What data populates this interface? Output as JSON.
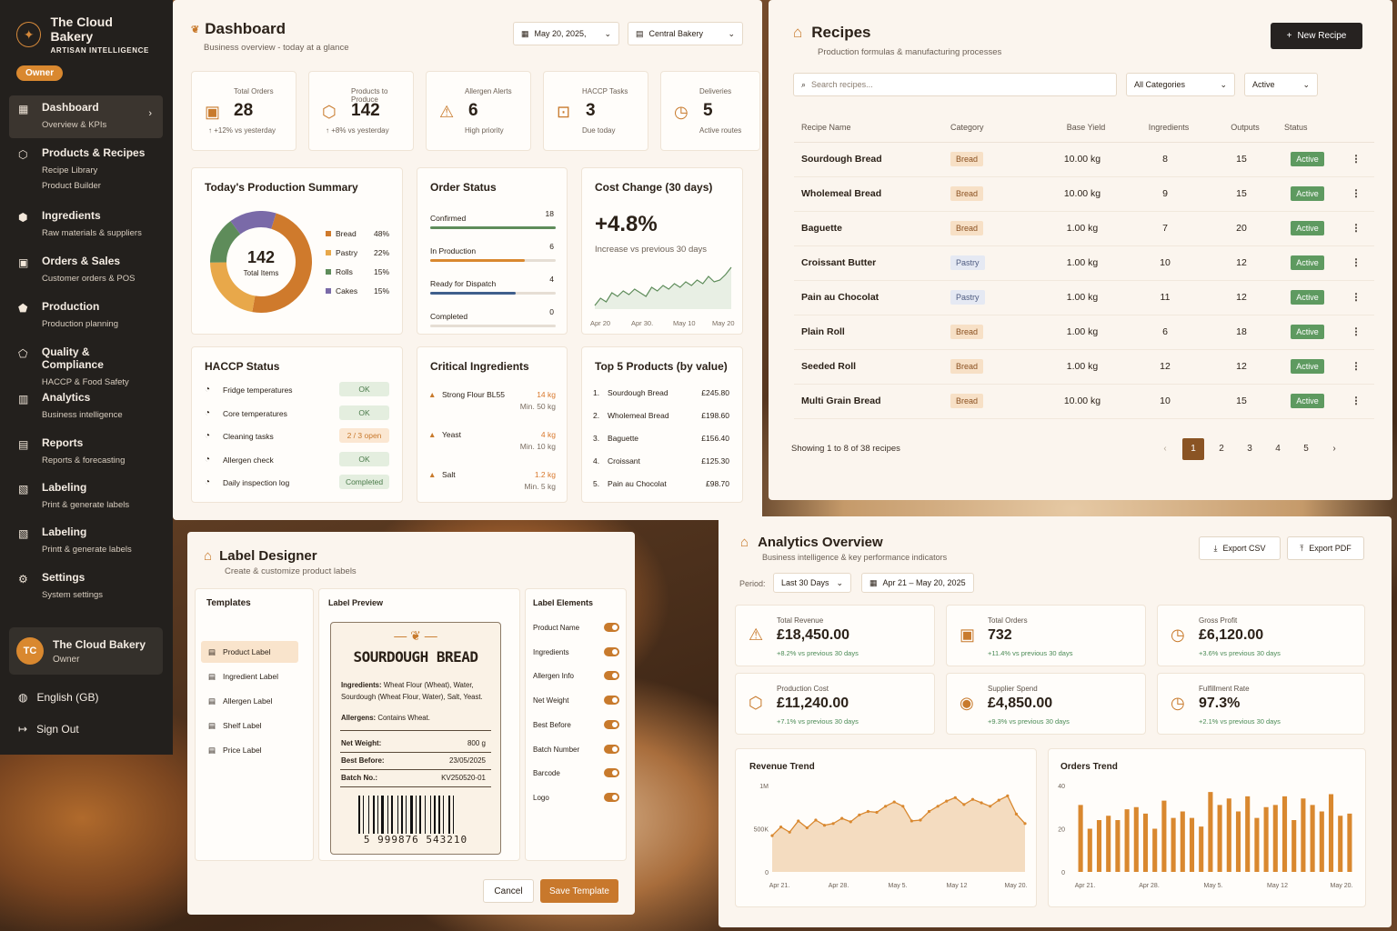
{
  "sidebar": {
    "brand": "The Cloud Bakery",
    "tagline": "ARTISAN INTELLIGENCE",
    "role": "Owner",
    "items": [
      {
        "title": "Dashboard",
        "sub": [
          "Overview & KPIs"
        ],
        "icon": "grid-icon"
      },
      {
        "title": "Products & Recipes",
        "sub": [
          "Recipe Library",
          "Product Builder"
        ],
        "icon": "box-icon"
      },
      {
        "title": "Ingredients",
        "sub": [
          "Raw materials & suppliers"
        ],
        "icon": "ingredient-icon"
      },
      {
        "title": "Orders & Sales",
        "sub": [
          "Customer orders & POS"
        ],
        "icon": "orders-icon"
      },
      {
        "title": "Production",
        "sub": [
          "Production planning"
        ],
        "icon": "production-icon"
      },
      {
        "title": "Quality & Compliance",
        "sub": [
          "HACCP & Food Safety"
        ],
        "icon": "shield-icon"
      },
      {
        "title": "Analytics",
        "sub": [
          "Business intelligence"
        ],
        "icon": "analytics-icon"
      },
      {
        "title": "Reports",
        "sub": [
          "Reports & forecasting"
        ],
        "icon": "reports-icon"
      },
      {
        "title": "Labeling",
        "sub": [
          "Print & generate labels"
        ],
        "icon": "label-icon"
      },
      {
        "title": "Labeling",
        "sub": [
          "Printt & generate labels"
        ],
        "icon": "label-icon"
      },
      {
        "title": "Settings",
        "sub": [
          "System settings"
        ],
        "icon": "gear-icon"
      }
    ],
    "user": {
      "initials": "TC",
      "name": "The Cloud Bakery",
      "role": "Owner"
    },
    "language": "English (GB)",
    "signout": "Sign Out"
  },
  "dashboard": {
    "title": "Dashboard",
    "subtitle": "Business overview - today at a glance",
    "date": "May 20, 2025,",
    "location": "Central Bakery",
    "kpis": [
      {
        "label": "Total Orders",
        "value": "28",
        "note": "↑ +12% vs yesterday"
      },
      {
        "label": "Products to Produce",
        "value": "142",
        "note": "↑ +8% vs yesterday"
      },
      {
        "label": "Allergen Alerts",
        "value": "6",
        "note": "High priority"
      },
      {
        "label": "HACCP Tasks",
        "value": "3",
        "note": "Due today"
      },
      {
        "label": "Deliveries",
        "value": "5",
        "note": "Active routes"
      }
    ],
    "summary": {
      "title": "Today's Production Summary",
      "total": "142",
      "total_label": "Total Items",
      "legend": [
        {
          "name": "Bread",
          "pct": "48%",
          "value": 48,
          "color": "#cf7a2c"
        },
        {
          "name": "Pastry",
          "pct": "22%",
          "value": 22,
          "color": "#e8a84a"
        },
        {
          "name": "Rolls",
          "pct": "15%",
          "value": 15,
          "color": "#5e8c5a"
        },
        {
          "name": "Cakes",
          "pct": "15%",
          "value": 15,
          "color": "#7a6aa8"
        }
      ]
    },
    "order_status": {
      "title": "Order Status",
      "items": [
        {
          "label": "Confirmed",
          "count": "18",
          "fill": 1.0,
          "color": "#5e8c5a"
        },
        {
          "label": "In Production",
          "count": "6",
          "fill": 0.75,
          "color": "#d9882f"
        },
        {
          "label": "Ready for Dispatch",
          "count": "4",
          "fill": 0.68,
          "color": "#3f5f8c"
        },
        {
          "label": "Completed",
          "count": "0",
          "fill": 0,
          "color": "#999"
        }
      ]
    },
    "cost": {
      "title": "Cost Change (30 days)",
      "value": "+4.8%",
      "note": "Increase vs previous 30 days",
      "ticks": [
        "Apr 20",
        "Apr 30.",
        "May 10",
        "May 20"
      ]
    },
    "haccp": {
      "title": "HACCP Status",
      "items": [
        {
          "label": "Fridge temperatures",
          "status": "OK"
        },
        {
          "label": "Core temperatures",
          "status": "OK"
        },
        {
          "label": "Cleaning tasks",
          "status": "2 / 3 open"
        },
        {
          "label": "Allergen check",
          "status": "OK"
        },
        {
          "label": "Daily inspection log",
          "status": "Completed"
        }
      ]
    },
    "critical": {
      "title": "Critical Ingredients",
      "items": [
        {
          "name": "Strong Flour BL55",
          "qty": "14 kg",
          "min": "Min. 50 kg"
        },
        {
          "name": "Yeast",
          "qty": "4 kg",
          "min": "Min. 10 kg"
        },
        {
          "name": "Salt",
          "qty": "1.2 kg",
          "min": "Min. 5 kg"
        }
      ]
    },
    "top5": {
      "title": "Top 5 Products (by value)",
      "items": [
        {
          "rank": "1.",
          "name": "Sourdough Bread",
          "value": "£245.80"
        },
        {
          "rank": "2.",
          "name": "Wholemeal Bread",
          "value": "£198.60"
        },
        {
          "rank": "3.",
          "name": "Baguette",
          "value": "£156.40"
        },
        {
          "rank": "4.",
          "name": "Croissant",
          "value": "£125.30"
        },
        {
          "rank": "5.",
          "name": "Pain au Chocolat",
          "value": "£98.70"
        }
      ]
    }
  },
  "recipes": {
    "title": "Recipes",
    "subtitle": "Production formulas & manufacturing processes",
    "new_button": "New Recipe",
    "search_placeholder": "Search recipes...",
    "category_filter": "All Categories",
    "status_filter": "Active",
    "headers": [
      "Recipe Name",
      "Category",
      "Base Yield",
      "Ingredients",
      "Outputs",
      "Status"
    ],
    "rows": [
      {
        "name": "Sourdough Bread",
        "category": "Bread",
        "yield": "10.00 kg",
        "ingredients": "8",
        "outputs": "15",
        "status": "Active"
      },
      {
        "name": "Wholemeal Bread",
        "category": "Bread",
        "yield": "10.00 kg",
        "ingredients": "9",
        "outputs": "15",
        "status": "Active"
      },
      {
        "name": "Baguette",
        "category": "Bread",
        "yield": "1.00 kg",
        "ingredients": "7",
        "outputs": "20",
        "status": "Active"
      },
      {
        "name": "Croissant Butter",
        "category": "Pastry",
        "yield": "1.00 kg",
        "ingredients": "10",
        "outputs": "12",
        "status": "Active"
      },
      {
        "name": "Pain au Chocolat",
        "category": "Pastry",
        "yield": "1.00 kg",
        "ingredients": "11",
        "outputs": "12",
        "status": "Active"
      },
      {
        "name": "Plain Roll",
        "category": "Bread",
        "yield": "1.00 kg",
        "ingredients": "6",
        "outputs": "18",
        "status": "Active"
      },
      {
        "name": "Seeded Roll",
        "category": "Bread",
        "yield": "1.00 kg",
        "ingredients": "12",
        "outputs": "12",
        "status": "Active"
      },
      {
        "name": "Multi Grain Bread",
        "category": "Bread",
        "yield": "10.00 kg",
        "ingredients": "10",
        "outputs": "15",
        "status": "Active"
      }
    ],
    "showing": "Showing 1 to 8 of 38 recipes",
    "pages": [
      "1",
      "2",
      "3",
      "4",
      "5"
    ],
    "prev": "‹",
    "next": "›"
  },
  "label_designer": {
    "title": "Label Designer",
    "subtitle": "Create & customize product labels",
    "templates_title": "Templates",
    "templates": [
      "Product Label",
      "Ingredient Label",
      "Allergen Label",
      "Shelf Label",
      "Price Label"
    ],
    "preview_title": "Label Preview",
    "product": "SOURDOUGH BREAD",
    "ingredients_label": "Ingredients:",
    "ingredients": "Wheat Flour (Wheat), Water, Sourdough (Wheat Flour, Water), Salt, Yeast.",
    "allergens_label": "Allergens:",
    "allergens": "Contains Wheat.",
    "fields": [
      {
        "k": "Net Weight:",
        "v": "800 g"
      },
      {
        "k": "Best Before:",
        "v": "23/05/2025"
      },
      {
        "k": "Batch No.:",
        "v": "KV250520-01"
      }
    ],
    "barcode_digits": "5 999876 543210",
    "elements_title": "Label Elements",
    "elements": [
      "Product Name",
      "Ingredients",
      "Allergen Info",
      "Net Weight",
      "Best Before",
      "Batch Number",
      "Barcode",
      "Logo"
    ],
    "cancel": "Cancel",
    "save": "Save Template"
  },
  "analytics": {
    "title": "Analytics Overview",
    "subtitle": "Business intelligence & key performance indicators",
    "export_csv": "Export CSV",
    "export_pdf": "Export PDF",
    "period_label": "Period:",
    "period": "Last 30 Days",
    "range": "Apr 21 – May 20, 2025",
    "kpis": [
      {
        "label": "Total Revenue",
        "value": "£18,450.00",
        "note": "+8.2% vs previous 30 days"
      },
      {
        "label": "Total Orders",
        "value": "732",
        "note": "+11.4% vs previous 30 days"
      },
      {
        "label": "Gross Profit",
        "value": "£6,120.00",
        "note": "+3.6% vs previous 30 days"
      },
      {
        "label": "Production Cost",
        "value": "£11,240.00",
        "note": "+7.1% vs previous 30 days"
      },
      {
        "label": "Supplier Spend",
        "value": "£4,850.00",
        "note": "+9.3% vs previous 30 days"
      },
      {
        "label": "Fulfillment Rate",
        "value": "97.3%",
        "note": "+2.1% vs previous 30 days"
      }
    ],
    "revenue_title": "Revenue Trend",
    "orders_title": "Orders Trend"
  },
  "chart_data": [
    {
      "type": "line",
      "title": "Cost Change (30 days)",
      "x": [
        "Apr 20",
        "Apr 30.",
        "May 10",
        "May 20"
      ],
      "values": [
        3.2,
        3.6,
        3.4,
        3.9,
        3.7,
        4.0,
        3.8,
        4.1,
        3.9,
        3.7,
        4.2,
        4.0,
        4.3,
        4.1,
        4.4,
        4.2,
        4.5,
        4.3,
        4.6,
        4.4,
        4.8,
        4.5,
        4.6,
        4.9,
        5.3
      ],
      "color": "#5e8c5a"
    },
    {
      "type": "area",
      "title": "Revenue Trend",
      "xticks": [
        "Apr 21.",
        "Apr 28.",
        "May 5.",
        "May 12",
        "May 20."
      ],
      "yticks": [
        "1M",
        "500K",
        "0"
      ],
      "ylim": [
        0,
        1000000
      ],
      "values": [
        420000,
        520000,
        460000,
        590000,
        510000,
        600000,
        540000,
        560000,
        620000,
        580000,
        660000,
        700000,
        690000,
        760000,
        810000,
        760000,
        590000,
        600000,
        700000,
        760000,
        820000,
        860000,
        780000,
        840000,
        800000,
        760000,
        830000,
        880000,
        670000,
        560000
      ]
    },
    {
      "type": "bar",
      "title": "Orders Trend",
      "xticks": [
        "Apr 21.",
        "Apr 28.",
        "May 5.",
        "May 12",
        "May 20."
      ],
      "yticks": [
        "40",
        "20",
        "0"
      ],
      "ylim": [
        0,
        40
      ],
      "values": [
        31,
        20,
        24,
        26,
        24,
        29,
        30,
        27,
        20,
        33,
        25,
        28,
        25,
        21,
        37,
        31,
        34,
        28,
        35,
        25,
        30,
        31,
        35,
        24,
        34,
        31,
        28,
        36,
        26,
        27
      ]
    }
  ]
}
